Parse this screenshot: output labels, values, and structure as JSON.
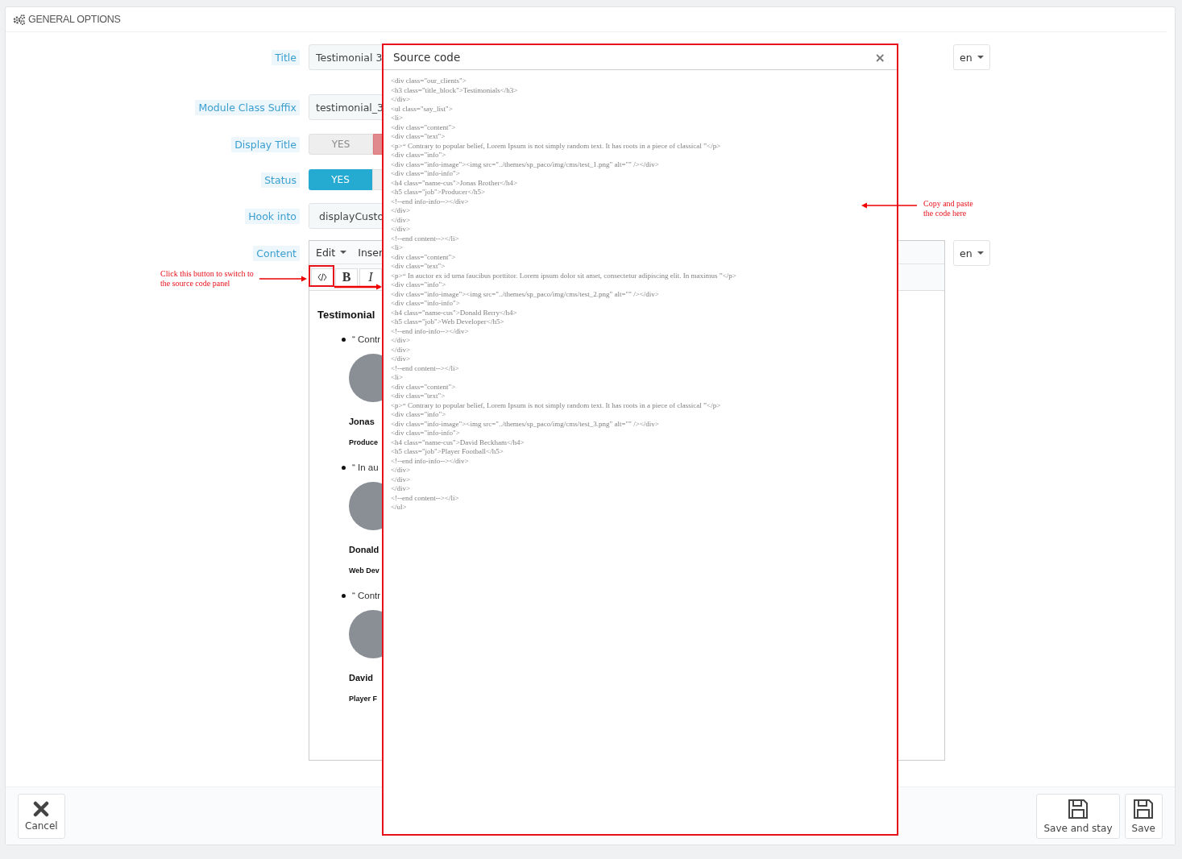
{
  "panel": {
    "title": "GENERAL OPTIONS"
  },
  "fields": [
    {
      "kind": "text",
      "label": "Title",
      "value": "Testimonial 3",
      "lang": "en"
    },
    {
      "kind": "text",
      "label": "Module Class Suffix",
      "value": "testimonial_3"
    },
    {
      "kind": "toggle",
      "label": "Display Title",
      "yes_label": "YES",
      "on": false
    },
    {
      "kind": "toggle",
      "label": "Status",
      "yes_label": "YES",
      "on": true
    },
    {
      "kind": "select",
      "label": "Hook into",
      "value": "displayCusto"
    },
    {
      "kind": "editor",
      "label": "Content",
      "lang": "en",
      "menu": [
        {
          "label": "Edit",
          "caret": true
        },
        {
          "label": "Inser"
        }
      ],
      "toolbar": [
        {
          "kind": "code"
        },
        {
          "kind": "bold",
          "label": "B"
        },
        {
          "kind": "italic",
          "label": "I"
        }
      ],
      "heading": "Testimonial",
      "items": [
        {
          "quote": "“ Contr",
          "name": "Jonas",
          "job": "Produce"
        },
        {
          "quote": "“ In au",
          "name": "Donald",
          "job": "Web Dev"
        },
        {
          "quote": "“ Contr",
          "name": "David",
          "job": "Player F"
        }
      ]
    }
  ],
  "dialog": {
    "title": "Source code",
    "close": "×",
    "code": [
      "<div class=\"our_clients\">",
      "<h3 class=\"title_block\">Testimonials</h3>",
      "</div>",
      "<ul class=\"say_list\">",
      "<li>",
      "<div class=\"content\">",
      "<div class=\"text\">",
      "<p>“ Contrary to popular belief, Lorem Ipsum is not simply random text. It has roots in a piece of classical ”</p>",
      "<div class=\"info\">",
      "<div class=\"info-image\"><img src=\"../themes/sp_paco/img/cms/test_1.png\" alt=\"\" /></div>",
      "<div class=\"info-info\">",
      "<h4 class=\"name-cus\">Jonas Brother</h4>",
      "<h5 class=\"job\">Producer</h5>",
      "<!--end info-info--></div>",
      "</div>",
      "</div>",
      "</div>",
      "<!--end content--></li>",
      "<li>",
      "<div class=\"content\">",
      "<div class=\"text\">",
      "<p>“ In auctor ex id urna faucibus porttitor. Lorem ipsum dolor sit amet, consectetur adipiscing elit. In maximus ”</p>",
      "<div class=\"info\">",
      "<div class=\"info-image\"><img src=\"../themes/sp_paco/img/cms/test_2.png\" alt=\"\" /></div>",
      "<div class=\"info-info\">",
      "<h4 class=\"name-cus\">Donald Berry</h4>",
      "<h5 class=\"job\">Web Developer</h5>",
      "<!--end info-info--></div>",
      "</div>",
      "</div>",
      "</div>",
      "<!--end content--></li>",
      "<li>",
      "<div class=\"content\">",
      "<div class=\"text\">",
      "<p>“ Contrary to popular belief, Lorem Ipsum is not simply random text. It has roots in a piece of classical ”</p>",
      "<div class=\"info\">",
      "<div class=\"info-image\"><img src=\"../themes/sp_paco/img/cms/test_3.png\" alt=\"\" /></div>",
      "<div class=\"info-info\">",
      "<h4 class=\"name-cus\">David Beckham</h4>",
      "<h5 class=\"job\">Player Football</h5>",
      "<!--end info-info--></div>",
      "</div>",
      "</div>",
      "</div>",
      "<!--end content--></li>",
      "</ul>"
    ]
  },
  "annotations": [
    {
      "kind": "left",
      "text": "Click this button to switch to the source code panel"
    },
    {
      "kind": "right",
      "text": "Copy and paste the code here"
    }
  ],
  "footer": {
    "cancel": "Cancel",
    "buttons": [
      "Save and stay",
      "Save"
    ]
  }
}
